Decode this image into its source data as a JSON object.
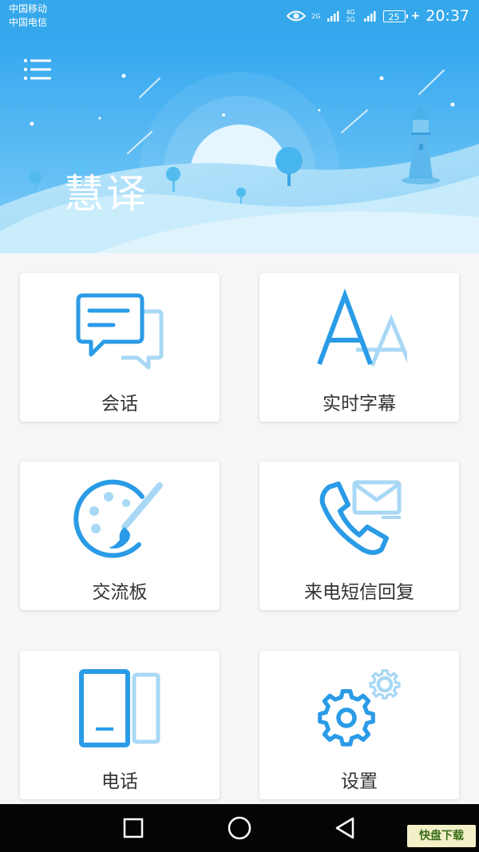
{
  "status_bar": {
    "carrier_1": "中国移动",
    "carrier_2": "中国电信",
    "sim1_network": "2G",
    "sim2_network": "4G 2G",
    "battery": "25",
    "time": "20:37",
    "icons": [
      "eye-icon",
      "signal-icon",
      "battery-icon",
      "charging-icon"
    ]
  },
  "header": {
    "menu_icon": "hamburger-menu-icon",
    "title": "慧译"
  },
  "features": [
    {
      "label": "会话",
      "icon": "chat-bubbles-icon"
    },
    {
      "label": "实时字幕",
      "icon": "letters-aa-icon"
    },
    {
      "label": "交流板",
      "icon": "palette-icon"
    },
    {
      "label": "来电短信回复",
      "icon": "phone-message-icon"
    },
    {
      "label": "电话",
      "icon": "phone-device-icon"
    },
    {
      "label": "设置",
      "icon": "gears-icon"
    }
  ],
  "nav_bar": {
    "icons": [
      "recents-square-icon",
      "home-circle-icon",
      "back-triangle-icon"
    ]
  },
  "watermark": {
    "text": "快盘下载"
  },
  "colors": {
    "accent": "#2a9be6",
    "accent_light": "#a8d8f5",
    "header_sky": "#3aa9ef",
    "status_bar": "#35a8ec"
  }
}
